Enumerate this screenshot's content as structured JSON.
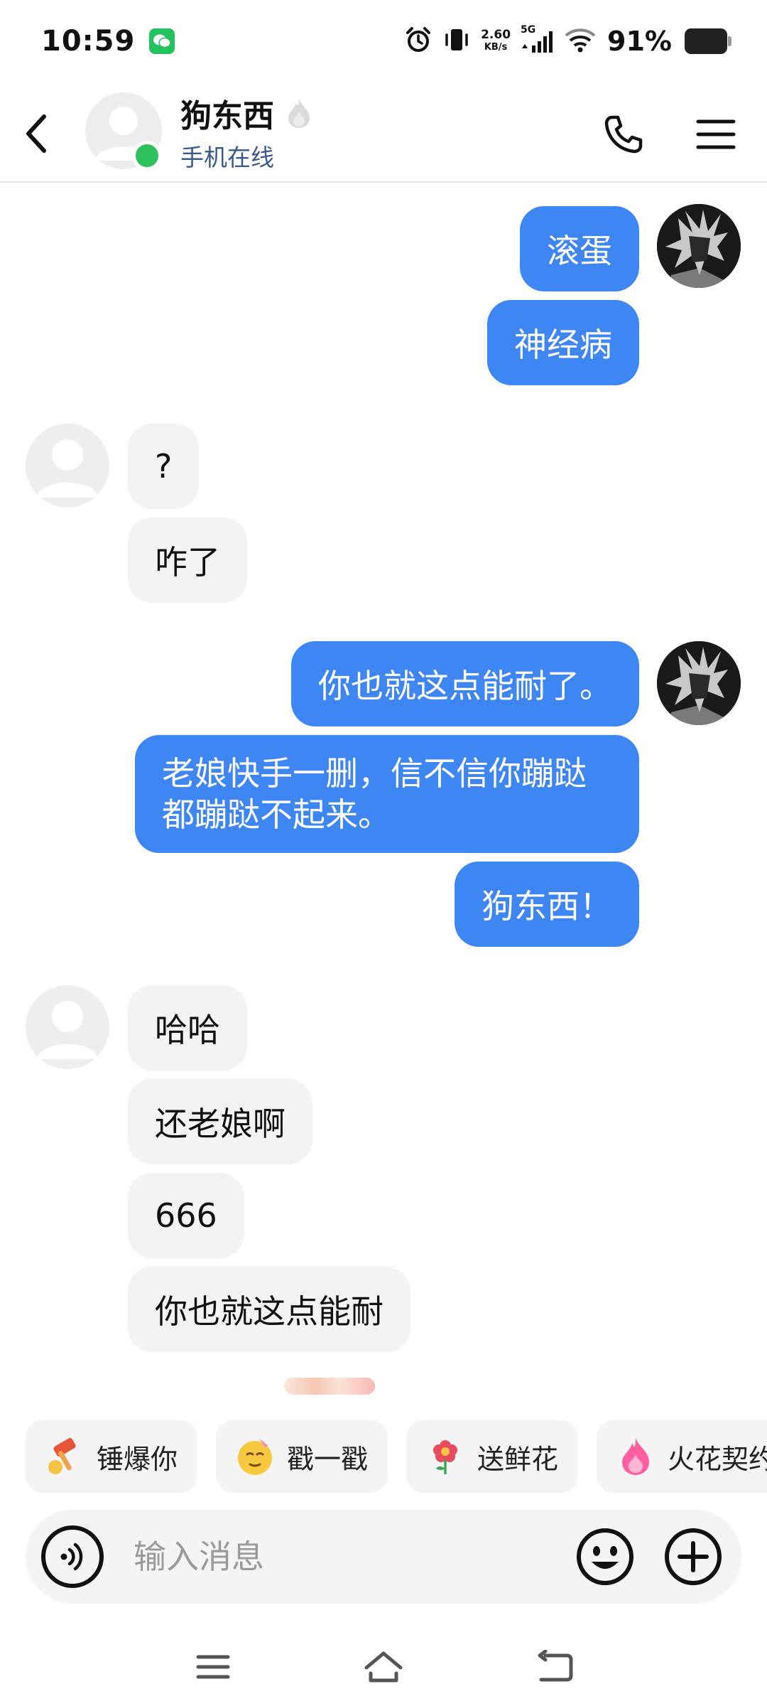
{
  "status_bar": {
    "time": "10:59",
    "net_speed_value": "2.60",
    "net_speed_unit": "KB/s",
    "network_type": "5G",
    "battery_percent": "91%"
  },
  "header": {
    "contact_name": "狗东西",
    "contact_status": "手机在线",
    "online_indicator_color": "#2ec05c"
  },
  "messages": [
    {
      "direction": "out",
      "text": "滚蛋"
    },
    {
      "direction": "out",
      "text": "神经病"
    },
    {
      "direction": "in",
      "text": "?"
    },
    {
      "direction": "in",
      "text": "咋了"
    },
    {
      "direction": "out",
      "text": "你也就这点能耐了。"
    },
    {
      "direction": "out",
      "text": "老娘快手一删，信不信你蹦跶都蹦跶不起来。"
    },
    {
      "direction": "out",
      "text": "狗东西！"
    },
    {
      "direction": "in",
      "text": "哈哈"
    },
    {
      "direction": "in",
      "text": "还老娘啊"
    },
    {
      "direction": "in",
      "text": "666"
    },
    {
      "direction": "in",
      "text": "你也就这点能耐"
    }
  ],
  "quick_actions": [
    {
      "label": "锤爆你",
      "icon": "hammer-icon"
    },
    {
      "label": "戳一戳",
      "icon": "poke-emoji-icon"
    },
    {
      "label": "送鲜花",
      "icon": "flower-icon"
    },
    {
      "label": "火花契约",
      "icon": "spark-flame-icon"
    }
  ],
  "input": {
    "placeholder": "输入消息"
  },
  "colors": {
    "outgoing_bubble": "#3e86f3",
    "incoming_bubble": "#f3f3f3",
    "accent_online": "#2ec05c",
    "status_text": "#3a5a8c"
  }
}
